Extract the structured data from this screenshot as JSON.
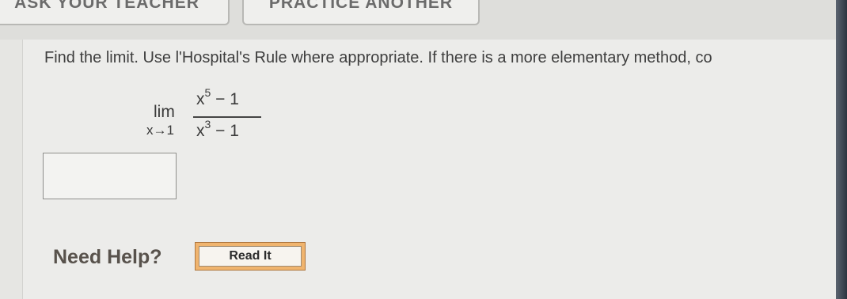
{
  "top_buttons": {
    "ask_teacher": "ASK YOUR TEACHER",
    "practice_another": "PRACTICE ANOTHER"
  },
  "question": {
    "prompt": "Find the limit. Use l'Hospital's Rule where appropriate. If there is a more elementary method, co",
    "limit": {
      "operator": "lim",
      "approach": "x→1",
      "numerator_base": "x",
      "numerator_exp": "5",
      "numerator_rest": " − 1",
      "denominator_base": "x",
      "denominator_exp": "3",
      "denominator_rest": " − 1"
    },
    "answer_value": ""
  },
  "help": {
    "label": "Need Help?",
    "read_it": "Read It"
  }
}
